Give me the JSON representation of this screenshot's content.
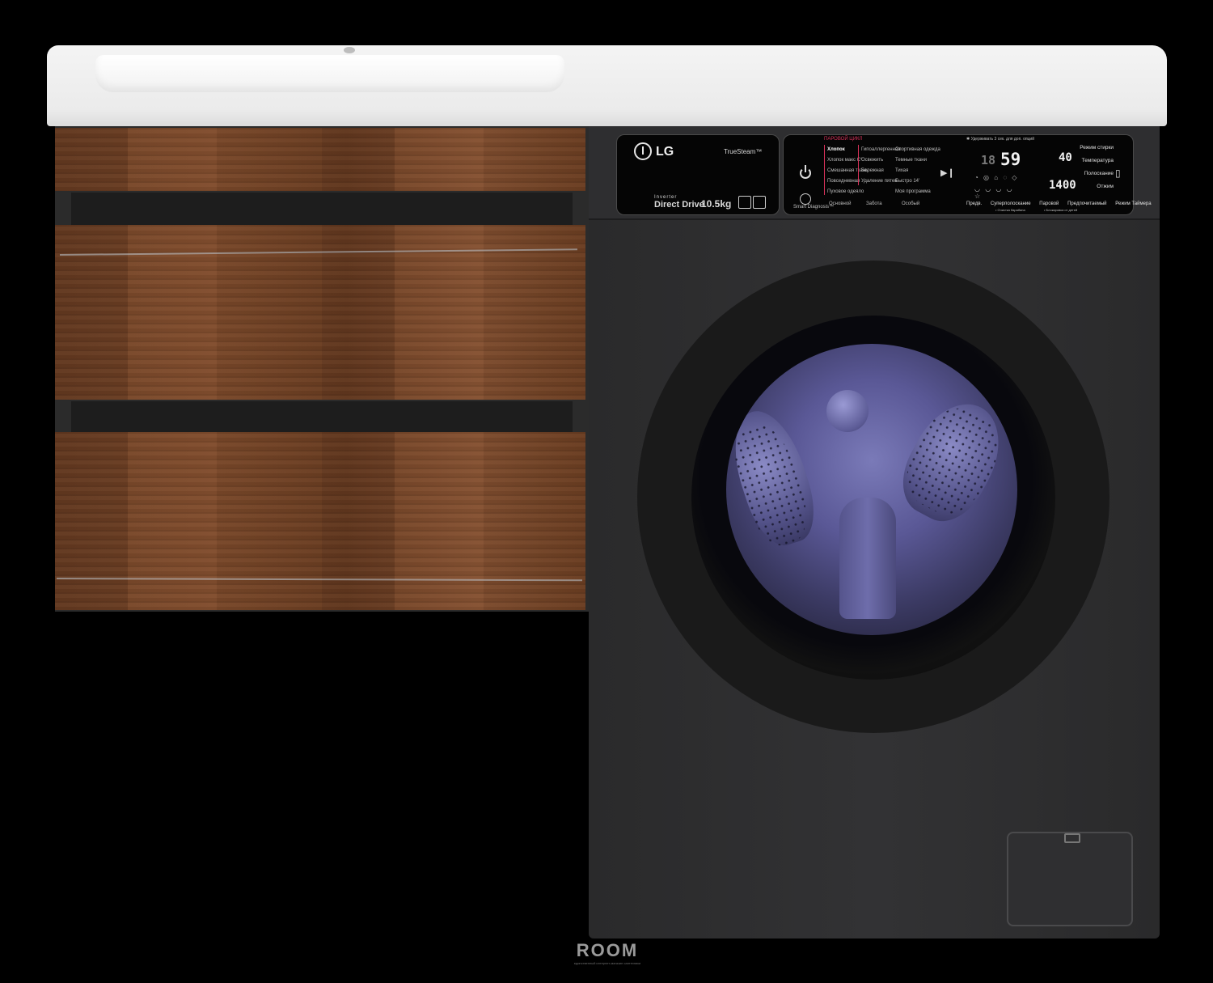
{
  "panel": {
    "brand": "LG",
    "truesteam": "TrueSteam™",
    "inverter": "Inverter",
    "direct_drive": "Direct Drive",
    "capacity": "10.5kg",
    "steam_header": "ПАРОВОЙ ЦИКЛ",
    "programs_col1": [
      "Хлопок",
      "Хлопок макс C°",
      "Смешанная ткань",
      "Повседневная",
      "Пуховое одеяло"
    ],
    "programs_col2": [
      "Гипоаллергенная",
      "Освежить",
      "Бережная",
      "Удаление пятен"
    ],
    "programs_col3": [
      "Спортивная одежда",
      "Темные ткани",
      "Тихая",
      "Быстро 14'",
      "Моя программа"
    ],
    "categories": [
      "Основной",
      "Забота",
      "Особый"
    ],
    "child_lock_note": "✱ Удерживать 3 сек. для доп. опций",
    "display_time": "59",
    "display_left": "18",
    "temperature_value": "40",
    "spin_value": "1400",
    "right_labels": [
      "Режим стирки",
      "Температура",
      "Полоскание",
      "Отжим"
    ],
    "bottom_buttons": [
      "Предв.",
      "Суперполоскание",
      "Паровой",
      "Предпочитаемый",
      "Режим Таймера"
    ],
    "bottom_sub": [
      "• Очистка барабана",
      "• Блокировка от детей"
    ],
    "smart_diagnosis": "Smart Diagnosis™"
  },
  "watermark": {
    "logo": "ROOM",
    "tagline": "единственный интернет-магазин сантехники"
  },
  "colors": {
    "background": "#000000",
    "countertop": "#f2f2f2",
    "wood": "#7a4a2c",
    "washer_body": "#2f2f31",
    "steam_red": "#d8325a"
  }
}
